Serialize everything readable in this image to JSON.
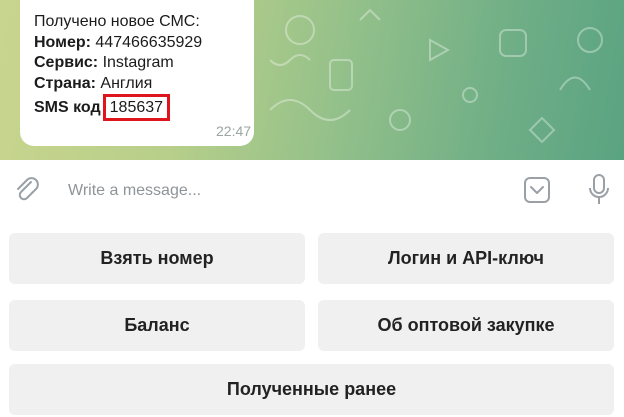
{
  "message": {
    "header": "Получено новое СМС:",
    "number_label": "Номер:",
    "number_value": "447466635929",
    "service_label": "Сервис:",
    "service_value": "Instagram",
    "country_label": "Страна:",
    "country_value": "Англия",
    "sms_code_label": "SMS код",
    "sms_code_value": "185637",
    "time": "22:47"
  },
  "composer": {
    "placeholder": "Write a message..."
  },
  "keyboard": {
    "buttons": [
      "Взять номер",
      "Логин и API-ключ",
      "Баланс",
      "Об оптовой закупке",
      "Полученные ранее"
    ]
  },
  "colors": {
    "highlight_border": "#e0141c",
    "button_bg": "#f0f0f0",
    "wallpaper_start": "#c9d58e",
    "wallpaper_end": "#5aa382"
  }
}
